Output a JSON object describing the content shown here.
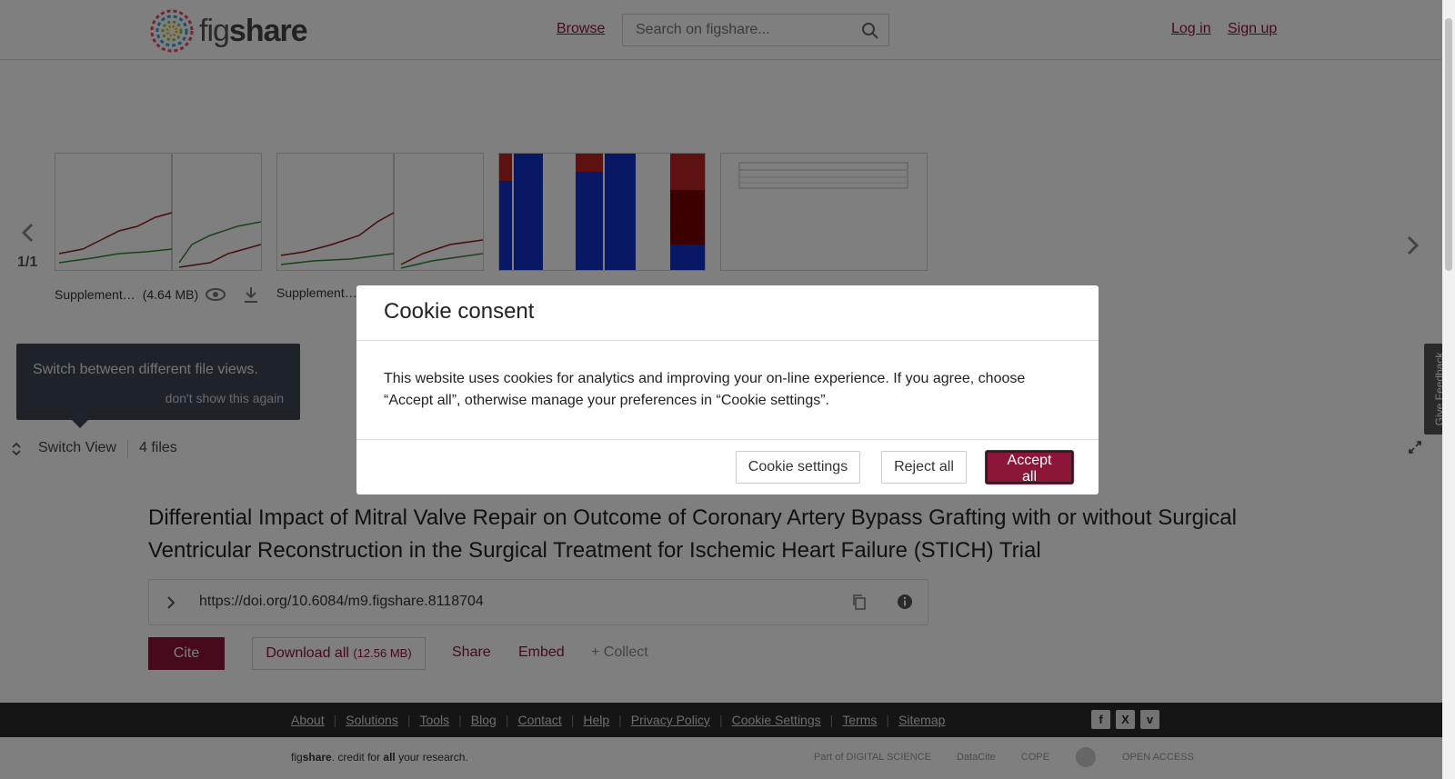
{
  "header": {
    "logo_text_light": "fig",
    "logo_text_bold": "share",
    "browse": "Browse",
    "search_placeholder": "Search on figshare...",
    "login": "Log in",
    "signup": "Sign up"
  },
  "preview": {
    "counter": "1/1",
    "files": [
      {
        "name": "Supplement…",
        "size": "(4.64 MB)"
      },
      {
        "name": "Supplement…",
        "size": ""
      }
    ],
    "tooltip": {
      "text": "Switch between different file views.",
      "dismiss": "don't show this again"
    },
    "switch_view": "Switch View",
    "files_count": "4 files",
    "feedback": "Give Feedback"
  },
  "article": {
    "title": "Differential Impact of Mitral Valve Repair on Outcome of Coronary Artery Bypass Grafting with or without Surgical Ventricular Reconstruction in the Surgical Treatment for Ischemic Heart Failure (STICH) Trial",
    "doi": "https://doi.org/10.6084/m9.figshare.8118704",
    "cite": "Cite",
    "download_all": "Download all",
    "download_size": "(12.56 MB)",
    "share": "Share",
    "embed": "Embed",
    "collect": "+ Collect"
  },
  "footer": {
    "links": [
      "About",
      "Solutions",
      "Tools",
      "Blog",
      "Contact",
      "Help",
      "Privacy Policy",
      "Cookie Settings",
      "Terms",
      "Sitemap"
    ],
    "tagline_fig": "fig",
    "tagline_share": "share",
    "tagline_mid": ". credit for ",
    "tagline_all": "all",
    "tagline_end": " your research.",
    "partners": [
      "Part of DIGITAL SCIENCE",
      "DataCite",
      "COPE",
      "",
      "OPEN ACCESS"
    ]
  },
  "cookie": {
    "title": "Cookie consent",
    "body": "This website uses cookies for analytics and improving your on-line experience. If you agree, choose “Accept all”, otherwise manage your preferences in “Cookie settings”.",
    "settings": "Cookie settings",
    "reject": "Reject all",
    "accept": "Accept all"
  },
  "colors": {
    "brand": "#8c1538",
    "tooltip_bg": "#3c4754",
    "footer_bg": "#2b2b2b"
  }
}
